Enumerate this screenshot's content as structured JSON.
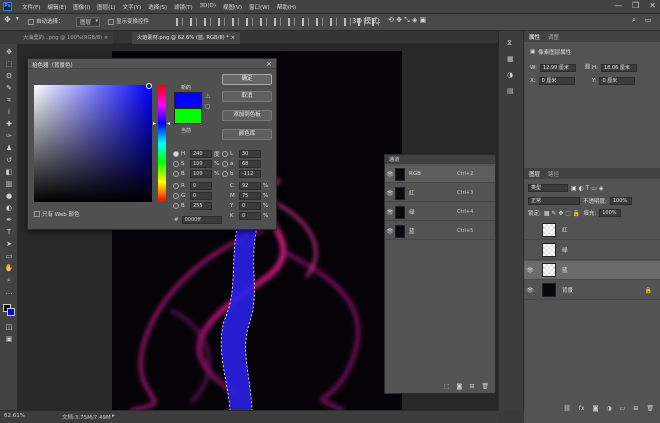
{
  "app": {
    "logo": "Ps"
  },
  "menubar": {
    "items": [
      "文件(F)",
      "编辑(E)",
      "图像(I)",
      "图层(L)",
      "文字(Y)",
      "选择(S)",
      "滤镜(T)",
      "3D(D)",
      "视图(V)",
      "窗口(W)",
      "帮助(H)"
    ],
    "window_controls": [
      "—",
      "❐",
      "✕"
    ]
  },
  "options": {
    "auto_select_label": "自动选择：",
    "auto_select_value": "图层",
    "show_transform_label": "显示变换控件"
  },
  "tabs": [
    {
      "label": "大海里的...png @ 100%(RGB/8)",
      "close": "×"
    },
    {
      "label": "火焰素材.png @ 62.6% (蓝, RGB/8) *",
      "close": "×"
    }
  ],
  "status": {
    "zoom": "62.61%",
    "doc": "文档:3.75M/7.49M",
    "arrow": "▸"
  },
  "color_picker": {
    "title": "拾色器（背景色）",
    "close": "×",
    "new_label": "新的",
    "current_label": "当前",
    "new_color": "#0000ff",
    "current_color": "#00ff00",
    "buttons": {
      "ok": "确定",
      "cancel": "取消",
      "add_swatch": "添加到色板",
      "libraries": "颜色库"
    },
    "fields": [
      {
        "name": "H",
        "value": "240",
        "unit": "度",
        "selected": true
      },
      {
        "name": "S",
        "value": "100",
        "unit": "%"
      },
      {
        "name": "B",
        "value": "100",
        "unit": "%"
      },
      {
        "name": "R",
        "value": "0",
        "unit": ""
      },
      {
        "name": "G",
        "value": "0",
        "unit": ""
      },
      {
        "name": "B",
        "value": "255",
        "unit": ""
      }
    ],
    "lab_fields": [
      {
        "name": "L",
        "value": "30",
        "unit": ""
      },
      {
        "name": "a",
        "value": "68",
        "unit": ""
      },
      {
        "name": "b",
        "value": "-112",
        "unit": ""
      },
      {
        "name": "C",
        "value": "92",
        "unit": "%"
      },
      {
        "name": "M",
        "value": "75",
        "unit": "%"
      },
      {
        "name": "Y",
        "value": "0",
        "unit": "%"
      },
      {
        "name": "K",
        "value": "0",
        "unit": "%"
      }
    ],
    "web_only_label": "只有 Web 颜色",
    "hex_prefix": "#",
    "hex_value": "0000ff"
  },
  "channels": {
    "title": "通道",
    "rows": [
      {
        "name": "RGB",
        "shortcut": "Ctrl+2"
      },
      {
        "name": "红",
        "shortcut": "Ctrl+3"
      },
      {
        "name": "绿",
        "shortcut": "Ctrl+4"
      },
      {
        "name": "蓝",
        "shortcut": "Ctrl+5"
      }
    ]
  },
  "properties": {
    "tabs": [
      "属性",
      "调整"
    ],
    "doc_title": "像素图层属性",
    "w_label": "W:",
    "w_value": "12.99 厘米",
    "h_label": "H:",
    "h_value": "18.06 厘米",
    "x_label": "X:",
    "x_value": "0 厘米",
    "y_label": "Y:",
    "y_value": "0 厘米"
  },
  "layers": {
    "tabs": [
      "图层",
      "路径"
    ],
    "filter_label": "类型",
    "blend_mode": "正常",
    "opacity_label": "不透明度:",
    "opacity_value": "100%",
    "lock_label": "锁定:",
    "fill_label": "填充:",
    "fill_value": "100%",
    "rows": [
      {
        "name": "红",
        "visible": false
      },
      {
        "name": "绿",
        "visible": false
      },
      {
        "name": "蓝",
        "visible": true,
        "selected": true
      },
      {
        "name": "背景",
        "visible": true,
        "locked": true
      }
    ]
  }
}
